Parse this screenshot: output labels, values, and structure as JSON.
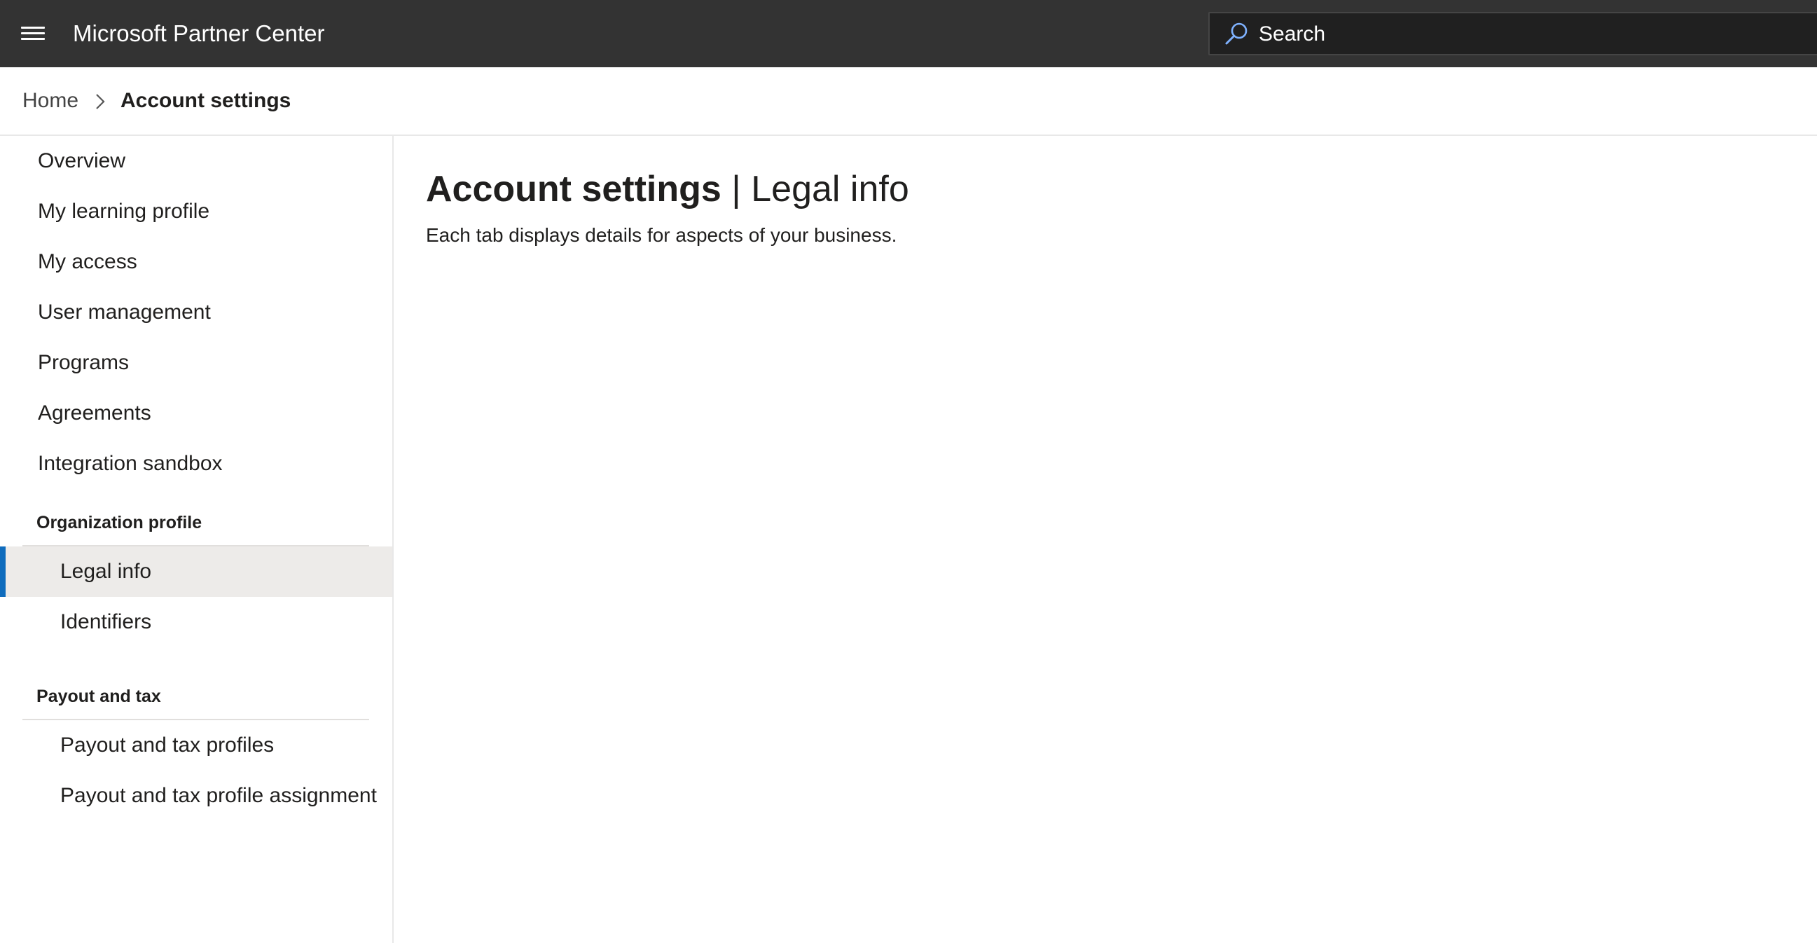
{
  "header": {
    "app_title": "Microsoft Partner Center",
    "search_placeholder": "Search",
    "search_value": ""
  },
  "breadcrumb": {
    "home": "Home",
    "current": "Account settings"
  },
  "sidebar": {
    "items": [
      {
        "label": "Overview"
      },
      {
        "label": "My learning profile"
      },
      {
        "label": "My access"
      },
      {
        "label": "User management"
      },
      {
        "label": "Programs"
      },
      {
        "label": "Agreements"
      },
      {
        "label": "Integration sandbox"
      }
    ],
    "org_section": {
      "title": "Organization profile",
      "items": [
        {
          "label": "Legal info",
          "selected": true
        },
        {
          "label": "Identifiers"
        }
      ]
    },
    "payout_section": {
      "title": "Payout and tax",
      "items": [
        {
          "label": "Payout and tax profiles"
        },
        {
          "label": "Payout and tax profile assignment"
        }
      ]
    }
  },
  "main": {
    "title_strong": "Account settings",
    "title_separator": " | ",
    "title_light": "Legal info",
    "description": "Each tab displays details for aspects of your business."
  },
  "colors": {
    "topbar_bg": "#333333",
    "selected_bg": "#edebe9",
    "selected_accent": "#0f6cbd"
  }
}
